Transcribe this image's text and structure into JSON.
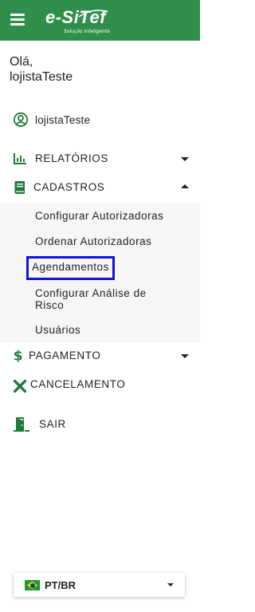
{
  "header": {
    "brand_name": "e-SiTef",
    "brand_tagline": "Solução Inteligente",
    "menu_icon": "hamburger-icon",
    "color": "#2f8f4a"
  },
  "greeting": {
    "line1": "Olá,",
    "line2": "lojistaTeste"
  },
  "user": {
    "name": "lojistaTeste",
    "icon": "user-circle-icon"
  },
  "menu": {
    "relatorios": {
      "label": "RELATÓRIOS",
      "icon": "bar-chart-icon",
      "state": "collapsed"
    },
    "cadastros": {
      "label": "CADASTROS",
      "icon": "book-icon",
      "state": "expanded"
    },
    "pagamento": {
      "label": "PAGAMENTO",
      "icon": "dollar-icon",
      "state": "collapsed"
    },
    "cancelamento": {
      "label": "CANCELAMENTO",
      "icon": "close-icon"
    },
    "sair": {
      "label": "SAIR",
      "icon": "exit-door-icon"
    }
  },
  "cadastros_items": [
    {
      "label": "Configurar Autorizadoras"
    },
    {
      "label": "Ordenar Autorizadoras"
    },
    {
      "label": "Agendamentos",
      "selected": true
    },
    {
      "label": "Configurar Análise de Risco"
    },
    {
      "label": "Usuários"
    }
  ],
  "language": {
    "selected": "PT/BR",
    "flag": "brazil-flag-icon"
  },
  "colors": {
    "accent": "#2f8f4a",
    "selection_outline": "#1010e0",
    "icon_green": "#1e7a38"
  }
}
